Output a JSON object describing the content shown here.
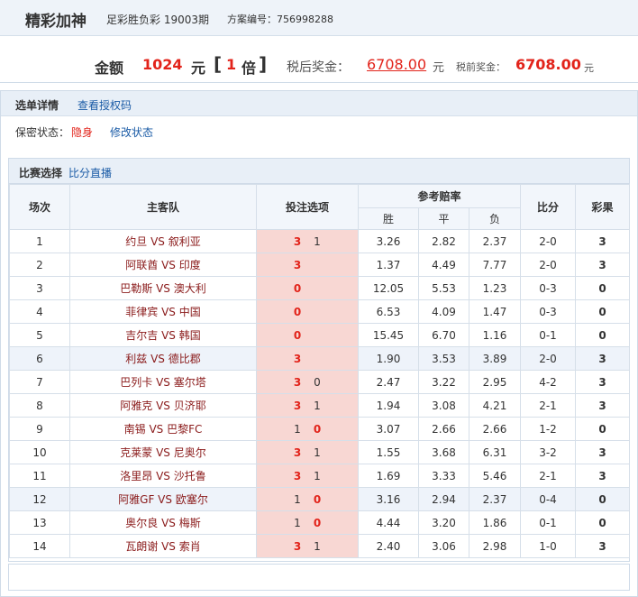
{
  "header": {
    "title": "精彩加神",
    "lottery": "足彩胜负彩 19003期",
    "plan_label": "方案编号：",
    "plan_no": "756998288"
  },
  "amount": {
    "label": "金额",
    "value": "1024",
    "unit": "元",
    "mult_left": "[",
    "mult_value": "1",
    "mult_unit": "倍",
    "mult_right": "]",
    "after_tax_label": "税后奖金：",
    "after_tax_value": "6708.00",
    "after_tax_unit": "元",
    "before_tax_label": "税前奖金：",
    "before_tax_value": "6708.00",
    "before_tax_unit": "元"
  },
  "detail": {
    "title": "选单详情",
    "link": "查看授权码",
    "secret_label": "保密状态：",
    "secret_value": "隐身",
    "modify_link": "修改状态"
  },
  "matches": {
    "title": "比赛选择",
    "link": "比分直播",
    "headers": {
      "no": "场次",
      "teams": "主客队",
      "pick": "投注选项",
      "odds": "参考赔率",
      "win": "胜",
      "draw": "平",
      "lose": "负",
      "score": "比分",
      "result": "彩果"
    },
    "rows": [
      {
        "no": "1",
        "teams": "约旦 VS 叙利亚",
        "p1": "3",
        "p2": "1",
        "win": "3.26",
        "draw": "2.82",
        "lose": "2.37",
        "score": "2-0",
        "result": "3"
      },
      {
        "no": "2",
        "teams": "阿联酋 VS 印度",
        "p1": "3",
        "p2": "",
        "win": "1.37",
        "draw": "4.49",
        "lose": "7.77",
        "score": "2-0",
        "result": "3"
      },
      {
        "no": "3",
        "teams": "巴勒斯 VS 澳大利",
        "p1": "0",
        "p2": "",
        "win": "12.05",
        "draw": "5.53",
        "lose": "1.23",
        "score": "0-3",
        "result": "0"
      },
      {
        "no": "4",
        "teams": "菲律宾 VS 中国",
        "p1": "0",
        "p2": "",
        "win": "6.53",
        "draw": "4.09",
        "lose": "1.47",
        "score": "0-3",
        "result": "0"
      },
      {
        "no": "5",
        "teams": "吉尔吉 VS 韩国",
        "p1": "0",
        "p2": "",
        "win": "15.45",
        "draw": "6.70",
        "lose": "1.16",
        "score": "0-1",
        "result": "0"
      },
      {
        "no": "6",
        "teams": "利兹 VS 德比郡",
        "p1": "3",
        "p2": "",
        "win": "1.90",
        "draw": "3.53",
        "lose": "3.89",
        "score": "2-0",
        "result": "3"
      },
      {
        "no": "7",
        "teams": "巴列卡 VS 塞尔塔",
        "p1": "3",
        "p2": "0",
        "win": "2.47",
        "draw": "3.22",
        "lose": "2.95",
        "score": "4-2",
        "result": "3"
      },
      {
        "no": "8",
        "teams": "阿雅克 VS 贝济耶",
        "p1": "3",
        "p2": "1",
        "win": "1.94",
        "draw": "3.08",
        "lose": "4.21",
        "score": "2-1",
        "result": "3"
      },
      {
        "no": "9",
        "teams": "南锡 VS 巴黎FC",
        "p1": "1",
        "p2": "0",
        "win": "3.07",
        "draw": "2.66",
        "lose": "2.66",
        "score": "1-2",
        "result": "0"
      },
      {
        "no": "10",
        "teams": "克莱蒙 VS 尼奥尔",
        "p1": "3",
        "p2": "1",
        "win": "1.55",
        "draw": "3.68",
        "lose": "6.31",
        "score": "3-2",
        "result": "3"
      },
      {
        "no": "11",
        "teams": "洛里昂 VS 沙托鲁",
        "p1": "3",
        "p2": "1",
        "win": "1.69",
        "draw": "3.33",
        "lose": "5.46",
        "score": "2-1",
        "result": "3"
      },
      {
        "no": "12",
        "teams": "阿雅GF VS 欧塞尔",
        "p1": "1",
        "p2": "0",
        "win": "3.16",
        "draw": "2.94",
        "lose": "2.37",
        "score": "0-4",
        "result": "0"
      },
      {
        "no": "13",
        "teams": "奥尔良 VS 梅斯",
        "p1": "1",
        "p2": "0",
        "win": "4.44",
        "draw": "3.20",
        "lose": "1.86",
        "score": "0-1",
        "result": "0"
      },
      {
        "no": "14",
        "teams": "瓦朗谢 VS 索肖",
        "p1": "3",
        "p2": "1",
        "win": "2.40",
        "draw": "3.06",
        "lose": "2.98",
        "score": "1-0",
        "result": "3"
      }
    ]
  }
}
